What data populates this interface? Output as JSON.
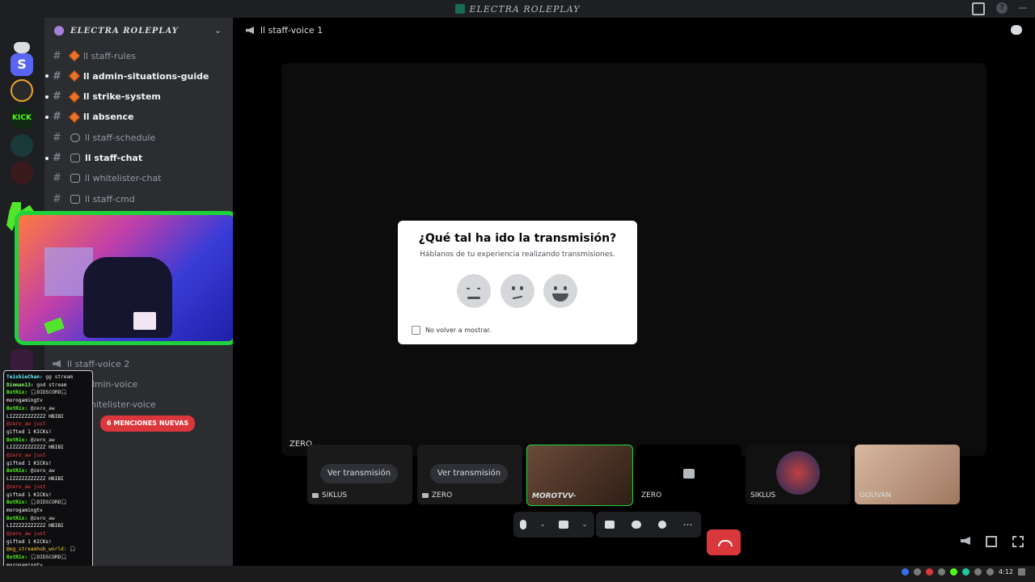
{
  "window": {
    "title": "ELECTRA ROLEPLAY"
  },
  "guild": {
    "name": "ELECTRA ROLEPLAY"
  },
  "channels": [
    {
      "label": "ll staff-rules",
      "icon": "hash",
      "emoji": "diamond",
      "bold": false
    },
    {
      "label": "ll admin-situations-guide",
      "icon": "hash",
      "emoji": "diamond",
      "bold": true
    },
    {
      "label": "ll strike-system",
      "icon": "hash",
      "emoji": "diamond",
      "bold": true
    },
    {
      "label": "ll absence",
      "icon": "hash",
      "emoji": "diamond",
      "bold": true
    },
    {
      "label": "ll staff-schedule",
      "icon": "hash",
      "emoji": "clock",
      "bold": false
    },
    {
      "label": "ll staff-chat",
      "icon": "hash",
      "emoji": "speech",
      "bold": true
    },
    {
      "label": "ll whitelister-chat",
      "icon": "hash",
      "emoji": "speech",
      "bold": false
    },
    {
      "label": "ll staff-cmd",
      "icon": "hash",
      "emoji": "wrench",
      "bold": false
    }
  ],
  "voice_channels": [
    {
      "label": "ll staff-voice 2"
    },
    {
      "label": "admin-voice"
    },
    {
      "label": "whitelister-voice"
    }
  ],
  "mentions_badge": "6 MENCIONES NUEVAS",
  "chat_lines": [
    {
      "user": "TeishieChan:",
      "text": " gg stream",
      "color": "#6cf0ff"
    },
    {
      "user": "Dinman13:",
      "text": " god stream",
      "color": "#8aff6c"
    },
    {
      "user": "BotRix:",
      "text": " 🎧DIDSCORD🎧",
      "color": "#53fc18"
    },
    {
      "user": "",
      "text": "morogamingtv",
      "color": "#ffffff"
    },
    {
      "user": "BotRix:",
      "text": " @zero_aw",
      "color": "#53fc18"
    },
    {
      "user": "",
      "text": "LIZZZZZZZZZZZ HBIBI",
      "color": "#ffffff"
    },
    {
      "user": "",
      "text": " @zero_aw just",
      "color": "#ff3c3c"
    },
    {
      "user": "",
      "text": "gifted 1 KICKs!",
      "color": "#ffffff"
    },
    {
      "user": "BotRix:",
      "text": " @zero_aw",
      "color": "#53fc18"
    },
    {
      "user": "",
      "text": "LIZZZZZZZZZZZ HBIBI",
      "color": "#ffffff"
    },
    {
      "user": "",
      "text": " @zero_aw just",
      "color": "#ff3c3c"
    },
    {
      "user": "",
      "text": "gifted 1 KICKs!",
      "color": "#ffffff"
    },
    {
      "user": "BotRix:",
      "text": " @zero_aw",
      "color": "#53fc18"
    },
    {
      "user": "",
      "text": "LIZZZZZZZZZZZ HBIBI",
      "color": "#ffffff"
    },
    {
      "user": "",
      "text": " @zero_aw just",
      "color": "#ff3c3c"
    },
    {
      "user": "",
      "text": "gifted 1 KICKs!",
      "color": "#ffffff"
    },
    {
      "user": "BotRix:",
      "text": " 🎧DIDSCORD🎧",
      "color": "#53fc18"
    },
    {
      "user": "",
      "text": "morogamingtv",
      "color": "#ffffff"
    },
    {
      "user": "BotRix:",
      "text": " @zero_aw",
      "color": "#53fc18"
    },
    {
      "user": "",
      "text": "LIZZZZZZZZZZZ HBIBI",
      "color": "#ffffff"
    },
    {
      "user": "",
      "text": " @zero_aw just",
      "color": "#ff3c3c"
    },
    {
      "user": "",
      "text": "gifted 1 KICKs!",
      "color": "#ffffff"
    },
    {
      "user": "",
      "text": "@eg_streamhub_world: 🎧",
      "color": "#ffcc33"
    },
    {
      "user": "BotRix:",
      "text": " 🎧DIDSCORD🎧",
      "color": "#53fc18"
    },
    {
      "user": "",
      "text": "morogamingtv",
      "color": "#ffffff"
    }
  ],
  "voice": {
    "channel": "ll staff-voice 1",
    "stage_label": "ZERO"
  },
  "tiles": [
    {
      "label": "SIKLUS",
      "watch": "Ver transmisión",
      "kind": "stream"
    },
    {
      "label": "ZERO",
      "watch": "Ver transmisión",
      "kind": "stream"
    },
    {
      "label": "MOROTVV-",
      "watch": "",
      "kind": "cam"
    },
    {
      "label": "ZERO",
      "watch": "",
      "kind": "camoff"
    },
    {
      "label": "SIKLUS",
      "watch": "",
      "kind": "avatar"
    },
    {
      "label": "GOUVAN",
      "watch": "",
      "kind": "cam2"
    }
  ],
  "popup": {
    "title": "¿Qué tal ha ido la transmisión?",
    "subtitle": "Háblanos de tu experiencia realizando transmisiones.",
    "checkbox_label": "No volver a mostrar."
  },
  "clock": "4:12",
  "colors": {
    "accent_green": "#1ed33a",
    "hangup": "#da373c",
    "badge": "#da373c"
  }
}
